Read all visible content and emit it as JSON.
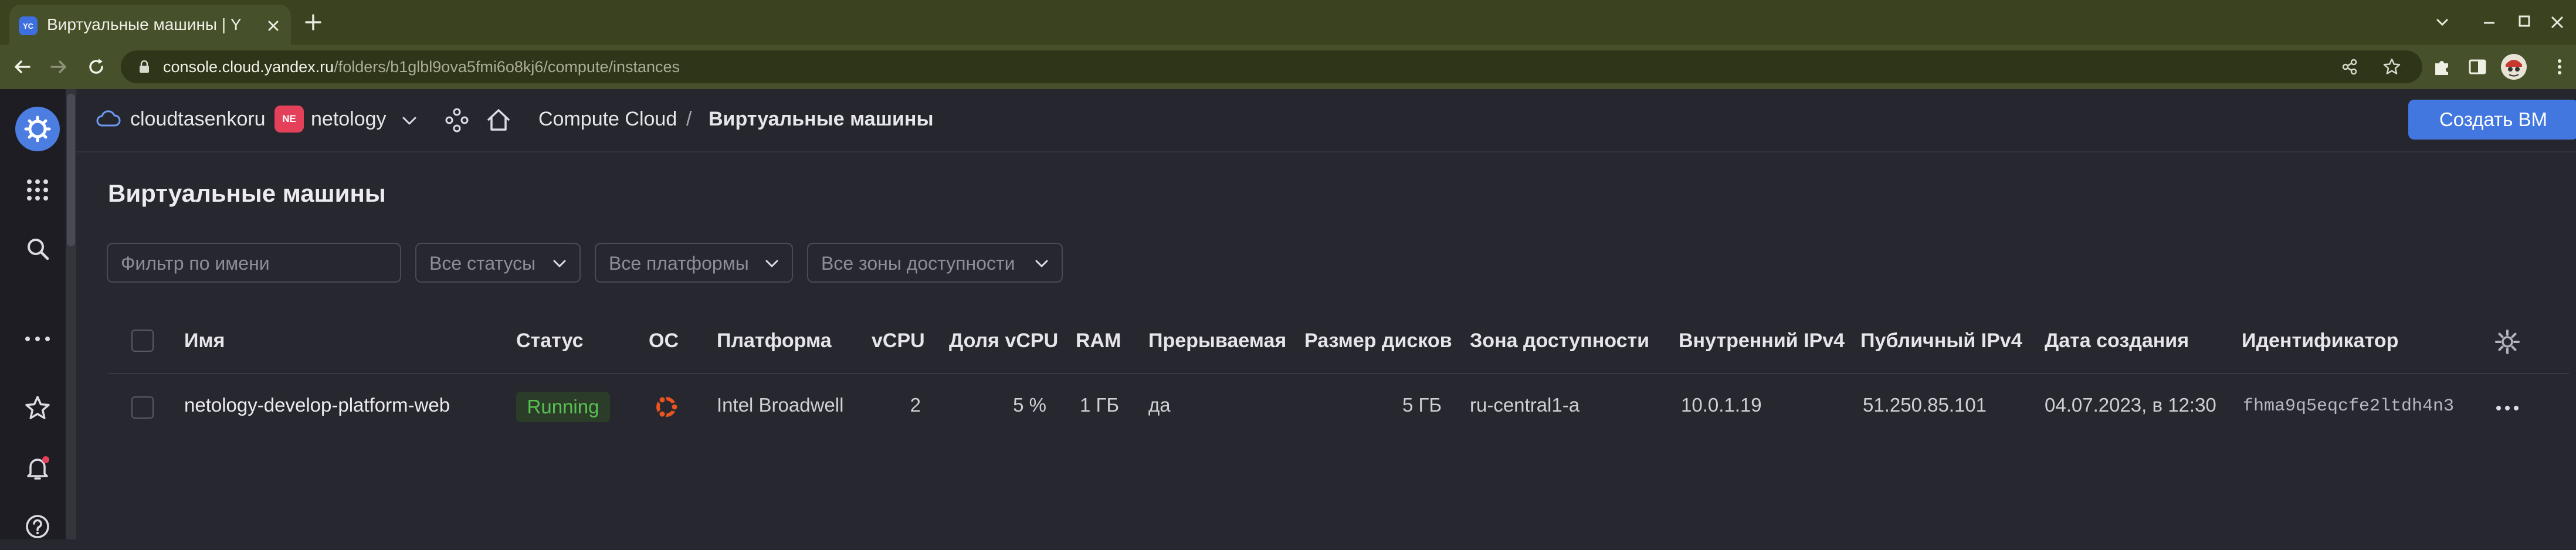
{
  "browser": {
    "tab_title": "Виртуальные машины | Y",
    "favicon_text": "YC",
    "url_host": "console.cloud.yandex.ru",
    "url_path": "/folders/b1glbl9ova5fmi6o8kj6/compute/instances"
  },
  "header": {
    "cloud_name": "cloudtasenkoru",
    "folder_badge": "NE",
    "folder_name": "netology",
    "breadcrumb_service": "Compute Cloud",
    "breadcrumb_separator": "/",
    "breadcrumb_current": "Виртуальные машины",
    "create_button": "Создать ВМ"
  },
  "page": {
    "title": "Виртуальные машины",
    "filters": {
      "name_placeholder": "Фильтр по имени",
      "status": "Все статусы",
      "platform": "Все платформы",
      "zone": "Все зоны доступности"
    }
  },
  "table": {
    "columns": {
      "name": "Имя",
      "status": "Статус",
      "os": "ОС",
      "platform": "Платформа",
      "vcpu": "vCPU",
      "vcpu_share": "Доля vCPU",
      "ram": "RAM",
      "preemptible": "Прерываемая",
      "disk_size": "Размер дисков",
      "zone": "Зона доступности",
      "internal_ip": "Внутренний IPv4",
      "public_ip": "Публичный IPv4",
      "created": "Дата создания",
      "id": "Идентификатор"
    },
    "rows": [
      {
        "name": "netology-develop-platform-web",
        "status": "Running",
        "os_icon": "ubuntu-icon",
        "platform": "Intel Broadwell",
        "vcpu": "2",
        "vcpu_share": "5 %",
        "ram": "1 ГБ",
        "preemptible": "да",
        "disk_size": "5 ГБ",
        "zone": "ru-central1-a",
        "internal_ip": "10.0.1.19",
        "public_ip": "51.250.85.101",
        "created": "04.07.2023, в 12:30",
        "id": "fhma9q5eqcfe2ltdh4n3"
      }
    ]
  },
  "colors": {
    "accent": "#4277e0",
    "running_text": "#58c052",
    "ubuntu": "#e95420",
    "notification_dot": "#e5405a"
  }
}
